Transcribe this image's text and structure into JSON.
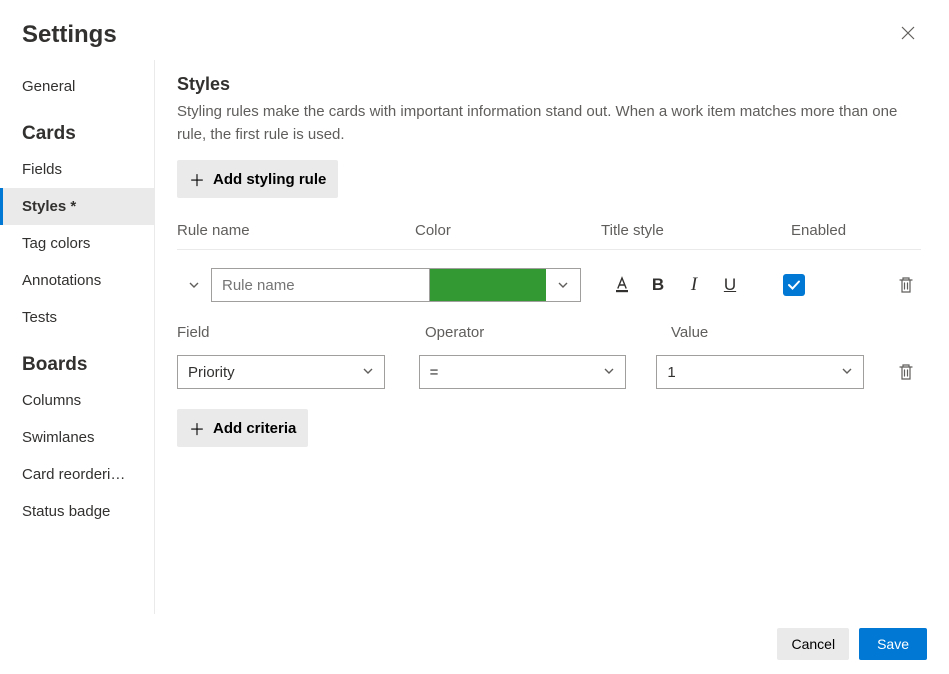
{
  "modal": {
    "title": "Settings"
  },
  "sidebar": {
    "items": [
      {
        "label": "General",
        "selected": false,
        "group": null
      },
      {
        "label": "Fields",
        "group": "Cards",
        "selected": false
      },
      {
        "label": "Styles *",
        "group": "Cards",
        "selected": true
      },
      {
        "label": "Tag colors",
        "group": "Cards",
        "selected": false
      },
      {
        "label": "Annotations",
        "group": "Cards",
        "selected": false
      },
      {
        "label": "Tests",
        "group": "Cards",
        "selected": false
      },
      {
        "label": "Columns",
        "group": "Boards",
        "selected": false
      },
      {
        "label": "Swimlanes",
        "group": "Boards",
        "selected": false
      },
      {
        "label": "Card reorderi…",
        "group": "Boards",
        "selected": false
      },
      {
        "label": "Status badge",
        "group": "Boards",
        "selected": false
      }
    ],
    "groups": {
      "cards": "Cards",
      "boards": "Boards"
    }
  },
  "styles": {
    "title": "Styles",
    "description": "Styling rules make the cards with important information stand out. When a work item matches more than one rule, the first rule is used.",
    "add_rule_label": "Add styling rule",
    "columns": {
      "name": "Rule name",
      "color": "Color",
      "title_style": "Title style",
      "enabled": "Enabled"
    },
    "rule": {
      "name_placeholder": "Rule name",
      "name_value": "",
      "color": "#339933",
      "enabled": true
    },
    "criteria": {
      "columns": {
        "field": "Field",
        "operator": "Operator",
        "value": "Value"
      },
      "row": {
        "field": "Priority",
        "operator": "=",
        "value": "1"
      },
      "add_label": "Add criteria"
    }
  },
  "footer": {
    "cancel": "Cancel",
    "save": "Save"
  }
}
